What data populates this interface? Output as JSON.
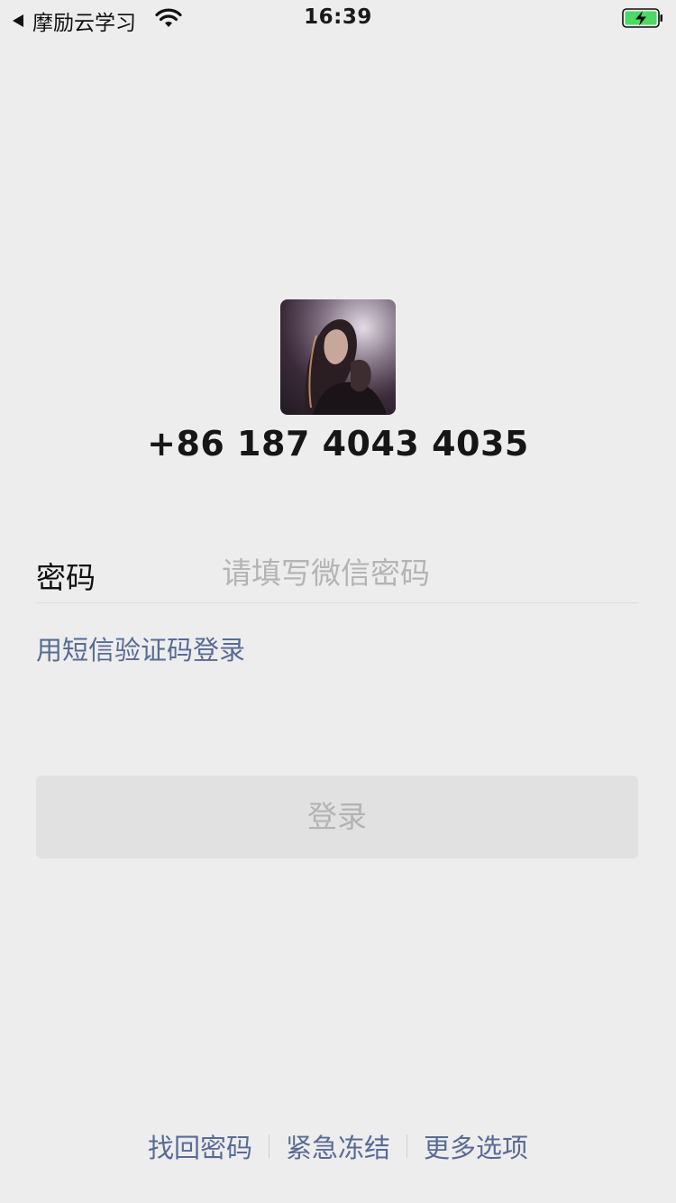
{
  "status_bar": {
    "back_app": "摩励云学习",
    "time": "16:39",
    "battery_state": "charging",
    "wifi_icon": "wifi-icon",
    "battery_icon": "battery-charging-icon"
  },
  "account": {
    "phone": "+86 187 4043 4035"
  },
  "password": {
    "label": "密码",
    "placeholder": "请填写微信密码",
    "value": ""
  },
  "sms_login_link": "用短信验证码登录",
  "login_button": "登录",
  "footer": {
    "links": [
      "找回密码",
      "紧急冻结",
      "更多选项"
    ]
  },
  "colors": {
    "background": "#ededed",
    "link": "#576b95",
    "button_disabled_bg": "#e1e1e1",
    "button_disabled_text": "#b3b3b3",
    "placeholder": "#b4b4b4",
    "battery_fill": "#4cd964"
  }
}
